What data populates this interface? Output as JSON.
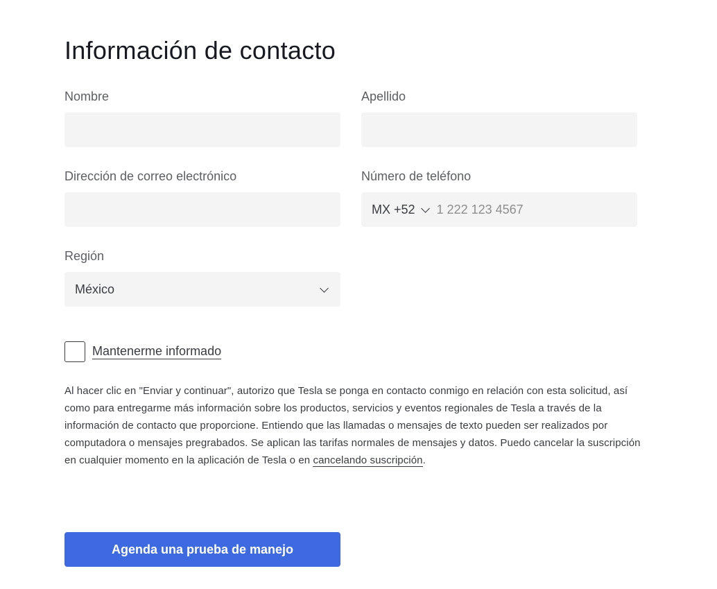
{
  "form": {
    "title": "Información de contacto",
    "first_name": {
      "label": "Nombre",
      "value": ""
    },
    "last_name": {
      "label": "Apellido",
      "value": ""
    },
    "email": {
      "label": "Dirección de correo electrónico",
      "value": ""
    },
    "phone": {
      "label": "Número de teléfono",
      "country_code": "MX +52",
      "placeholder": "1 222 123 4567",
      "value": ""
    },
    "region": {
      "label": "Región",
      "selected": "México"
    },
    "keep_informed": {
      "label": "Mantenerme informado",
      "checked": false
    },
    "disclaimer": {
      "text": "Al hacer clic en \"Enviar y continuar\", autorizo que Tesla se ponga en contacto conmigo en relación con esta solicitud, así como para entregarme más información sobre los productos, servicios y eventos regionales de Tesla a través de la información de contacto que proporcione. Entiendo que las llamadas o mensajes de texto pueden ser realizados por computadora o mensajes pregrabados. Se aplican las tarifas normales de mensajes y datos. Puedo cancelar la suscripción en cualquier momento en la aplicación de Tesla o en ",
      "link": "cancelando suscripción",
      "end": "."
    },
    "submit_label": "Agenda una prueba de manejo"
  },
  "colors": {
    "accent": "#3e6ae1",
    "field_bg": "#f4f4f4",
    "text": "#393c41"
  }
}
